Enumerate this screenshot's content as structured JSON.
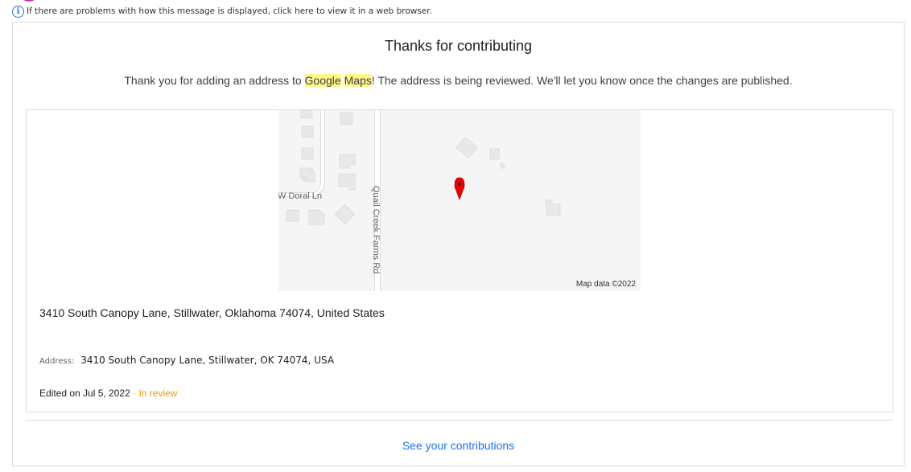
{
  "infobar": {
    "text": "If there are problems with how this message is displayed, click here to view it in a web browser."
  },
  "email": {
    "title": "Thanks for contributing",
    "subtitle_before": "Thank you for adding an address to ",
    "highlight_1": "Google",
    "highlight_2": "Maps",
    "subtitle_after": "! The address is being reviewed. We'll let you know once the changes are published.",
    "map": {
      "street_1": "W Doral Ln",
      "street_2": "Quail Creek Farms Rd",
      "credit": "Map data ©2022",
      "marker_color": "#ea0000"
    },
    "place_name": "3410 South Canopy Lane, Stillwater, Oklahoma 74074, United States",
    "address_label": "Address:",
    "address_value": "3410 South Canopy Lane, Stillwater, OK 74074, USA",
    "edited_text": "Edited on Jul 5, 2022",
    "separator": " · ",
    "status": "In review",
    "status_color": "#f29900",
    "link_text": "See your contributions",
    "link_color": "#1a73e8"
  }
}
